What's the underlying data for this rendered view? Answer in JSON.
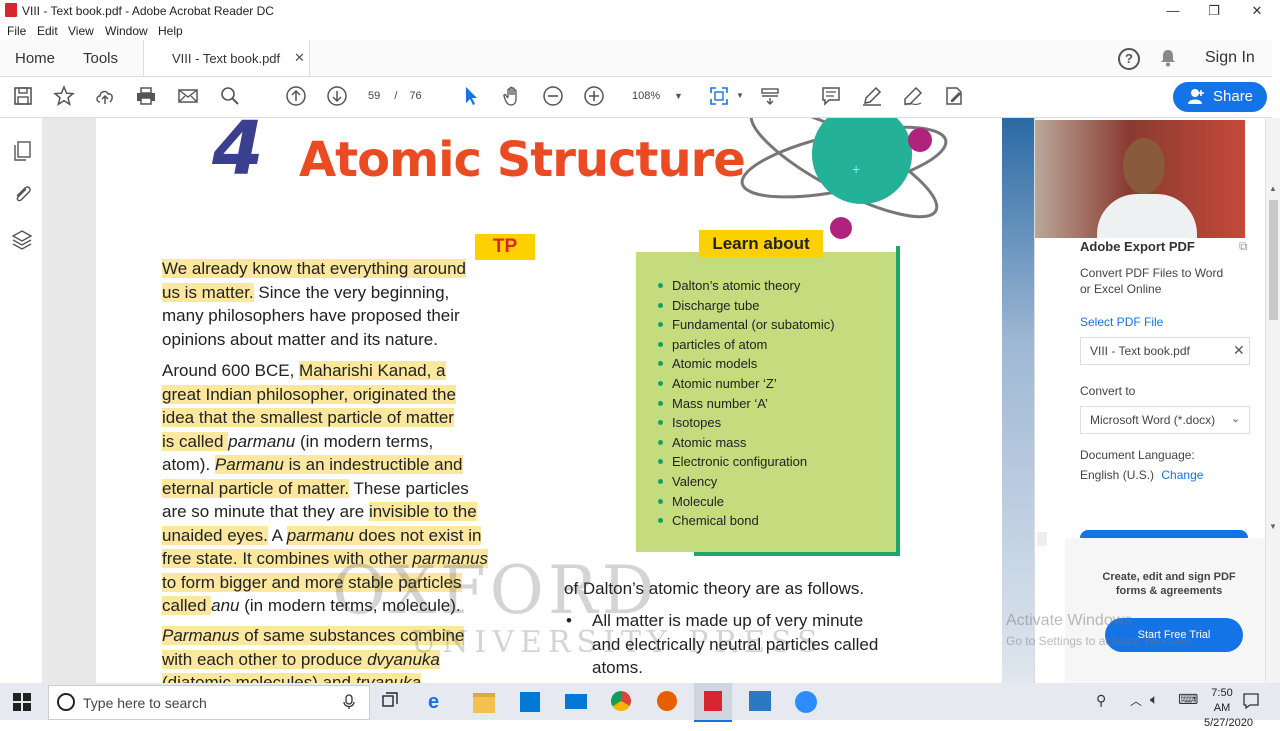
{
  "window": {
    "title": "VIII - Text book.pdf - Adobe Acrobat Reader DC",
    "controls": {
      "minimize": "—",
      "restore": "❐",
      "close": "✕"
    }
  },
  "menu": [
    "File",
    "Edit",
    "View",
    "Window",
    "Help"
  ],
  "tabs": {
    "home": "Home",
    "tools": "Tools",
    "document": "VIII - Text book.pdf",
    "close_glyph": "✕"
  },
  "header_right": {
    "help": "?",
    "sign_in": "Sign In"
  },
  "toolbar": {
    "page_current": "59",
    "page_separator": "/",
    "page_total": "76",
    "zoom": "108%",
    "share_label": "Share"
  },
  "document": {
    "chapter_number": "4",
    "chapter_title": "Atomic Structure",
    "tp_badge": "TP",
    "learn_about_title": "Learn about",
    "learn_about_items": [
      "Dalton’s atomic theory",
      "Discharge tube",
      "Fundamental (or subatomic)",
      "particles of atom",
      "Atomic models",
      "Atomic number ‘Z’",
      "Mass number ‘A’",
      "Isotopes",
      "Atomic mass",
      "Electronic configuration",
      "Valency",
      "Molecule",
      "Chemical bond"
    ],
    "para1": {
      "l1": "We already know that everything around",
      "l2a": "us is matter.",
      "l2b": " Since the very beginning,",
      "l3": "many philosophers have proposed their",
      "l4": "opinions about matter and its nature."
    },
    "para2": {
      "l1a": "Around 600 BCE, ",
      "l1b": "Maharishi Kanad, a",
      "l2": "great Indian philosopher, originated the",
      "l3": "idea that the smallest particle of matter",
      "l4a": "is called ",
      "l4b": "parmanu",
      "l4c": " (in modern terms,",
      "l5a": "atom). ",
      "l5b": "Parmanu",
      "l5c": " is an indestructible and",
      "l6a": "eternal particle of matter.",
      "l6b": " These particles",
      "l7a": "are so minute that they are ",
      "l7b": "invisible to the",
      "l8a": "unaided eyes.",
      "l8b": " A ",
      "l8c": "parmanu",
      "l8d": " does not exist in",
      "l9a": "free state. It combines with other ",
      "l9b": "parmanus",
      "l10": "to form bigger and more stable particles",
      "l11a": "called ",
      "l11b": "anu",
      "l11c": " (in modern terms, molecule)."
    },
    "para3": {
      "l1a": "Parmanus",
      "l1b": " of same substances combine",
      "l2a": "with each other to produce ",
      "l2b": "dvyanuka",
      "l3a": "(diatomic molecules) and ",
      "l3b": "tryanuka"
    },
    "right_text": {
      "l1": "of Dalton’s atomic theory are as follows.",
      "b1": "All matter is made up of very minute",
      "b2": "and electrically neutral particles called",
      "b3": "atoms."
    },
    "watermark_1": "OXFORD",
    "watermark_2": "UNIVERSITY PRESS"
  },
  "export_pane": {
    "title": "Adobe Export PDF",
    "description_1": "Convert PDF Files to Word",
    "description_2": "or Excel Online",
    "select_file_label": "Select PDF File",
    "file_name": "VIII - Text book.pdf",
    "convert_to_label": "Convert to",
    "convert_format": "Microsoft Word (*.docx)",
    "language_label": "Document Language:",
    "language_value": "English (U.S.)",
    "change_link": "Change",
    "promo_1": "Create, edit and sign PDF",
    "promo_2": "forms & agreements",
    "trial_button": "Start Free Trial"
  },
  "activation": {
    "line1": "Activate Windows",
    "line2": "Go to Settings to activate Windows."
  },
  "taskbar": {
    "search_placeholder": "Type here to search",
    "time": "7:50 AM",
    "date": "5/27/2020"
  },
  "colors": {
    "accent_blue": "#1473e6",
    "chapter_red": "#ea4b23",
    "chapter_number_blue": "#3b3f8f",
    "highlight": "#fbe89e",
    "learn_box": "#c4dc7d",
    "learn_title_bg": "#fdd000"
  }
}
